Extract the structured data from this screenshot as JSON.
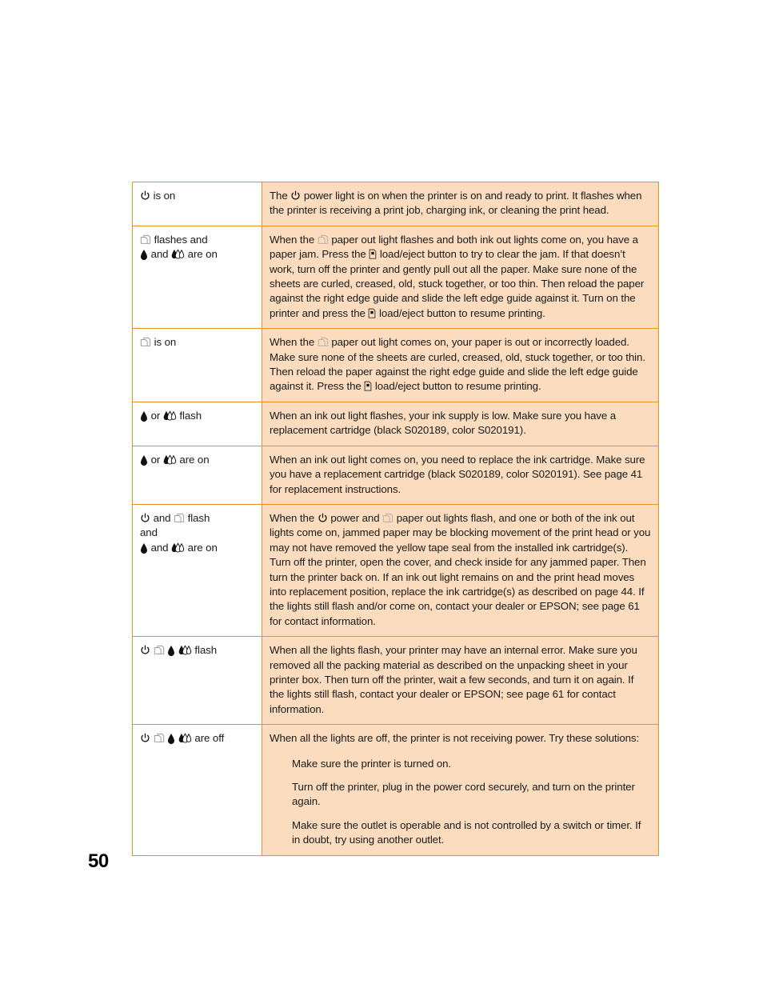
{
  "document": {
    "page_number": "50",
    "colors": {
      "table_border": "#ed9122",
      "description_cell_background": "#fbdcbe",
      "condition_cell_background": "#ffffff",
      "text": "#1a1a1a"
    }
  },
  "icons": {
    "power": "power-icon",
    "paper_out": "paper-out-icon",
    "black_ink": "black-ink-icon",
    "color_ink": "color-ink-icon",
    "load_eject": "load-eject-icon"
  },
  "table": {
    "rows": [
      {
        "id": "power-on",
        "condition_lines": [
          {
            "icons": [
              "power"
            ],
            "text": " is on"
          }
        ],
        "description_parts": [
          {
            "type": "text",
            "value": "The "
          },
          {
            "type": "icon",
            "value": "power"
          },
          {
            "type": "text",
            "value": " power light is on when the printer is on and ready to print. It flashes when the printer is receiving a print job, charging ink, or cleaning the print head."
          }
        ],
        "description_plain": "The  power light is on when the printer is on and ready to print. It flashes when the printer is receiving a print job, charging ink, or cleaning the print head."
      },
      {
        "id": "paper-jam",
        "condition_lines": [
          {
            "icons": [
              "paper_out"
            ],
            "text": " flashes and"
          },
          {
            "icons": [
              "black_ink",
              "color_ink"
            ],
            "text": " and  are on"
          }
        ],
        "description_plain": "When the  paper out light flashes and both ink out lights come on, you have a paper jam. Press the  load/eject button to try to clear the jam. If that doesn't work, turn off the printer and gently pull out all the paper. Make sure none of the sheets are curled, creased, old, stuck together, or too thin. Then reload the paper against the right edge guide and slide the left edge guide against it. Turn on the printer and press the  load/eject button to resume printing."
      },
      {
        "id": "paper-out",
        "condition_lines": [
          {
            "icons": [
              "paper_out"
            ],
            "text": " is on"
          }
        ],
        "description_plain": "When the  paper out light comes on, your paper is out or incorrectly loaded. Make sure none of the sheets are curled, creased, old, stuck together, or too thin. Then reload the paper against the right edge guide and slide the left edge guide against it. Press the  load/eject button to resume printing."
      },
      {
        "id": "ink-low",
        "condition_lines": [
          {
            "icons": [
              "black_ink",
              "color_ink"
            ],
            "text": " or  flash"
          }
        ],
        "description_plain": "When an ink out light flashes, your ink supply is low. Make sure you have a replacement cartridge (black S020189, color S020191)."
      },
      {
        "id": "ink-out",
        "condition_lines": [
          {
            "icons": [
              "black_ink",
              "color_ink"
            ],
            "text": " or  are on"
          }
        ],
        "description_plain": "When an ink out light comes on, you need to replace the ink cartridge. Make sure you have a replacement cartridge (black S020189, color S020191). See page 41 for replacement instructions."
      },
      {
        "id": "carriage-jam",
        "condition_lines": [
          {
            "icons": [
              "power",
              "paper_out"
            ],
            "text": " and  flash"
          },
          {
            "icons": [],
            "text": "and"
          },
          {
            "icons": [
              "black_ink",
              "color_ink"
            ],
            "text": " and  are on"
          }
        ],
        "description_plain": "When the  power and  paper out lights flash, and one or both of the ink out lights come on, jammed paper may be blocking movement of the print head or you may not have removed the yellow tape seal from the installed ink cartridge(s). Turn off the printer, open the cover, and check inside for any jammed paper. Then turn the printer back on. If an ink out light remains on and the print head moves into replacement position, replace the ink cartridge(s) as described on page 44. If the lights still flash and/or come on, contact your dealer or EPSON; see page 61 for contact information."
      },
      {
        "id": "all-flash",
        "condition_lines": [
          {
            "icons": [
              "power",
              "paper_out",
              "black_ink",
              "color_ink"
            ],
            "text": " flash"
          }
        ],
        "description_plain": "When all the lights flash, your printer may have an internal error. Make sure you removed all the packing material as described on the unpacking sheet in your printer box. Then turn off the printer, wait a few seconds, and turn it on again. If the lights still flash, contact your dealer or EPSON; see page 61 for contact information."
      },
      {
        "id": "all-off",
        "condition_lines": [
          {
            "icons": [
              "power",
              "paper_out",
              "black_ink",
              "color_ink"
            ],
            "text": " are off"
          }
        ],
        "description_plain": "When all the lights are off, the printer is not receiving power. Try these solutions:",
        "sub_items": [
          "Make sure the printer is turned on.",
          "Turn off the printer, plug in the power cord securely, and turn on the printer again.",
          "Make sure the outlet is operable and is not controlled by a switch or timer. If in doubt, try using another outlet."
        ]
      }
    ]
  },
  "text_fragments": {
    "row1_desc_a": "The ",
    "row1_desc_b": " power light is on when the printer is on and ready to print. It flashes when the printer is receiving a print job, charging ink, or cleaning the print head.",
    "row2_cond1": " flashes and",
    "row2_cond2a": " and ",
    "row2_cond2b": " are on",
    "row2_desc_a": "When the ",
    "row2_desc_b": " paper out light flashes and both ink out lights come on, you have a paper jam. Press the ",
    "row2_desc_c": " load/eject button to try to clear the jam. If that doesn’t work, turn off the printer and gently pull out all the paper. Make sure none of the sheets are curled, creased, old, stuck together, or too thin. Then reload the paper against the right edge guide and slide the left edge guide against it. Turn on the printer and press the ",
    "row2_desc_d": " load/eject button to resume printing.",
    "row3_cond1": " is on",
    "row3_desc_a": "When the ",
    "row3_desc_b": " paper out light comes on, your paper is out or incorrectly loaded. Make sure none of the sheets are curled, creased, old, stuck together, or too thin. Then reload the paper against the right edge guide and slide the left edge guide against it. Press the ",
    "row3_desc_c": " load/eject button to resume printing.",
    "row4_cond1a": " or ",
    "row4_cond1b": " flash",
    "row4_desc": "When an ink out light flashes, your ink supply is low. Make sure you have a replacement cartridge (black S020189, color S020191).",
    "row5_cond1a": " or ",
    "row5_cond1b": " are on",
    "row5_desc": "When an ink out light comes on, you need to replace the ink cartridge. Make sure you have a replacement cartridge (black S020189, color S020191). See page 41 for replacement instructions.",
    "row6_cond1a": " and ",
    "row6_cond1b": " flash",
    "row6_cond2": "and",
    "row6_cond3a": " and ",
    "row6_cond3b": " are on",
    "row6_desc_a": "When the ",
    "row6_desc_b": " power and ",
    "row6_desc_c": " paper out lights flash, and one or both of the ink out lights come on, jammed paper may be blocking movement of the print head or you may not have removed the yellow tape seal from the installed ink cartridge(s). Turn off the printer, open the cover, and check inside for any jammed paper. Then turn the printer back on. If an ink out light remains on and the print head moves into replacement position, replace the ink cartridge(s) as described on page 44. If the lights still flash and/or come on, contact your dealer or EPSON; see page 61 for contact information.",
    "row7_cond1": " flash",
    "row7_desc": "When all the lights flash, your printer may have an internal error. Make sure you removed all the packing material as described on the unpacking sheet in your printer box. Then turn off the printer, wait a few seconds, and turn it on again. If the lights still flash, contact your dealer or EPSON; see page 61 for contact information.",
    "row8_cond1": " are off",
    "row8_desc": "When all the lights are off, the printer is not receiving power. Try these solutions:",
    "row8_sub1": "Make sure the printer is turned on.",
    "row8_sub2": "Turn off the printer, plug in the power cord securely, and turn on the printer again.",
    "row8_sub3": "Make sure the outlet is operable and is not controlled by a switch or timer. If in doubt, try using another outlet."
  }
}
